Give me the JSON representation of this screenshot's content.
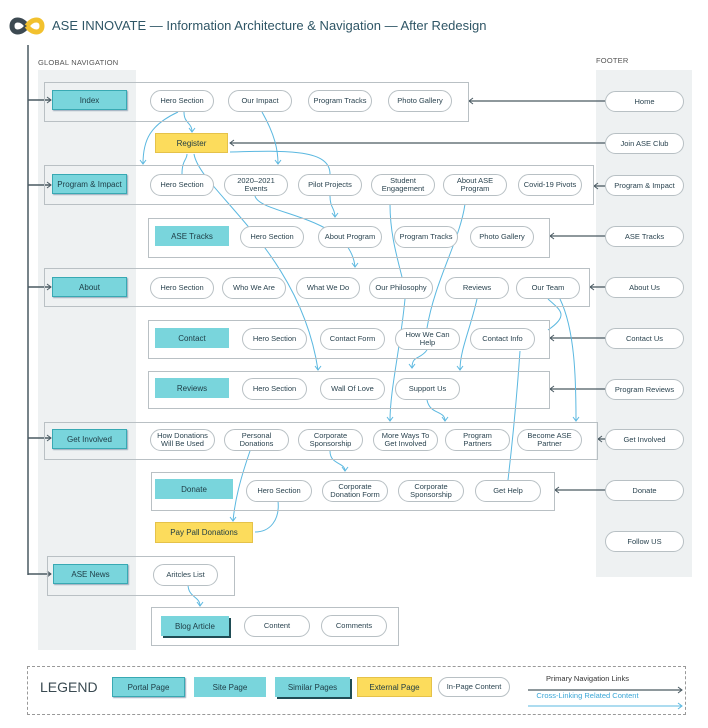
{
  "title": "ASE INNOVATE — Information Architecture & Navigation — After Redesign",
  "logo_icon": "infinity-gear-logo-icon",
  "global_nav_label": "GLOBAL NAVIGATION",
  "footer_label": "FOOTER",
  "sections": [
    {
      "page": "Index",
      "type": "portal",
      "items": [
        "Hero Section",
        "Our Impact",
        "Program Tracks",
        "Photo Gallery"
      ]
    },
    {
      "page": "Program & Impact",
      "type": "portal",
      "items": [
        "Hero Section",
        "2020–2021 Events",
        "Pilot Projects",
        "Student Engagement",
        "About ASE Program",
        "Covid-19 Pivots"
      ]
    },
    {
      "page": "ASE Tracks",
      "type": "site",
      "items": [
        "Hero Section",
        "About Program",
        "Program Tracks",
        "Photo Gallery"
      ]
    },
    {
      "page": "About",
      "type": "portal",
      "items": [
        "Hero Section",
        "Who We Are",
        "What We Do",
        "Our Philosophy",
        "Reviews",
        "Our Team"
      ]
    },
    {
      "page": "Contact",
      "type": "site",
      "items": [
        "Hero Section",
        "Contact Form",
        "How We Can Help",
        "Contact Info"
      ]
    },
    {
      "page": "Reviews",
      "type": "site",
      "items": [
        "Hero Section",
        "Wall Of Love",
        "Support Us"
      ]
    },
    {
      "page": "Get Involved",
      "type": "portal",
      "items": [
        "How Donations Will Be Used",
        "Personal Donations",
        "Corporate Sponsorship",
        "More Ways To Get Involved",
        "Program Partners",
        "Become ASE Partner"
      ]
    },
    {
      "page": "Donate",
      "type": "site",
      "items": [
        "Hero Section",
        "Corporate Donation Form",
        "Corporate Sponsorship",
        "Get Help"
      ]
    },
    {
      "page": "ASE News",
      "type": "portal",
      "items": [
        "Aritcles List"
      ]
    },
    {
      "page": "Blog Article",
      "type": "similar",
      "items": [
        "Content",
        "Comments"
      ]
    }
  ],
  "external": [
    "Register",
    "Pay Pall Donations"
  ],
  "footer": [
    "Home",
    "Join ASE Club",
    "Program & Impact",
    "ASE Tracks",
    "About Us",
    "Contact Us",
    "Program Reviews",
    "Get Involved",
    "Donate",
    "Follow US"
  ],
  "legend": {
    "title": "LEGEND",
    "items": [
      {
        "label": "Portal Page",
        "type": "portal"
      },
      {
        "label": "Site Page",
        "type": "site"
      },
      {
        "label": "Similar Pages",
        "type": "similar"
      },
      {
        "label": "External Page",
        "type": "external"
      },
      {
        "label": "In-Page Content",
        "type": "pill"
      }
    ],
    "primary": "Primary Navigation Links",
    "cross": "Cross-Linking Related Content"
  },
  "colors": {
    "portal": "#79d5dc",
    "external": "#fcdc5c",
    "primary_link": "#4a5a62",
    "cross_link": "#5bb8e0",
    "column_bg": "#eef1f2"
  }
}
